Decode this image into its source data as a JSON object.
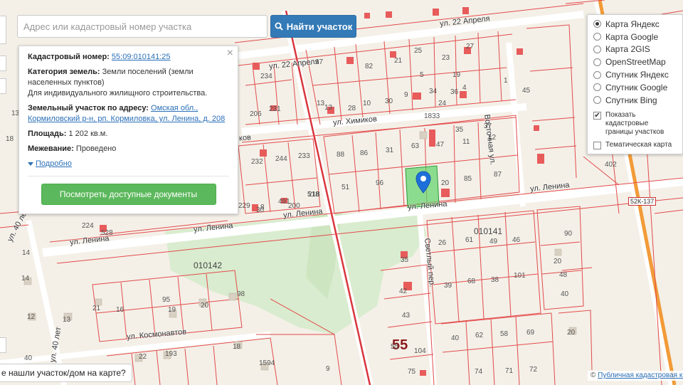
{
  "search": {
    "placeholder": "Адрес или кадастровый номер участка",
    "button_label": "Найти участок",
    "button_icon": "search-icon"
  },
  "info_panel": {
    "cadastral_label": "Кадастровый номер:",
    "cadastral_number": "55:09:010141:25",
    "category_label": "Категория земель:",
    "category_value": "Земли поселений (земли населенных пунктов)",
    "category_purpose": "Для индивидуального жилищного строительства.",
    "address_label": "Земельный участок по адресу:",
    "address_value": "Омская обл., Кормиловский р-н, рп. Кормиловка, ул. Ленина, д. 208",
    "area_label": "Площадь:",
    "area_value": "1 202 кв.м.",
    "survey_label": "Межевание:",
    "survey_value": "Проведено",
    "more_label": "Подробно",
    "docs_button": "Посмотреть доступные документы",
    "close_icon": "close-icon"
  },
  "layers": {
    "options": [
      {
        "label": "Карта Яндекс",
        "selected": true
      },
      {
        "label": "Карта Google",
        "selected": false
      },
      {
        "label": "Карта 2GIS",
        "selected": false
      },
      {
        "label": "OpenStreetMap",
        "selected": false
      },
      {
        "label": "Спутник Яндекс",
        "selected": false
      },
      {
        "label": "Спутник Google",
        "selected": false
      },
      {
        "label": "Спутник Bing",
        "selected": false
      }
    ],
    "show_borders_label": "Показать кадастровые границы участков",
    "show_borders_checked": true,
    "thematic_label": "Тематическая карта",
    "thematic_checked": false
  },
  "map": {
    "streets": {
      "s22april": "ул. 22 Апреля",
      "s22april2": "ул. 22 Апреля",
      "chemists": "ул. Химиков",
      "chemists_partial": "ков",
      "lenina_east": "ул. Ленина",
      "lenina_mid": "ул. Ленина",
      "lenina_w1": "ул. Ленина",
      "lenina_w2": "ул. Ленина",
      "lenina_w3": "ул. Ленина",
      "cosmonauts": "ул. Космонавтов",
      "vostochnaya": "Восточная ул.",
      "svetly": "Светлый пер.",
      "let40": "ул. 40 лет",
      "let40b": "ул. 40 лет"
    },
    "quarters": {
      "q141": "010141",
      "q142": "010142",
      "q55": "55",
      "road": "52К-137"
    },
    "plot_numbers": [
      "25",
      "23",
      "27",
      "17",
      "82",
      "21",
      "19",
      "5",
      "13",
      "10",
      "30",
      "9",
      "234",
      "206",
      "231",
      "1833",
      "28",
      "34",
      "36",
      "24",
      "13",
      "35",
      "37",
      "1",
      "4",
      "45",
      "88",
      "86",
      "31",
      "63",
      "47",
      "11",
      "12",
      "232",
      "244",
      "233",
      "218",
      "96",
      "20",
      "85",
      "87",
      "51",
      "30",
      "491",
      "518",
      "200",
      "229",
      "8",
      "224",
      "528",
      "26",
      "61",
      "49",
      "46",
      "90",
      "35",
      "39",
      "68",
      "38",
      "101",
      "48",
      "42",
      "43",
      "55",
      "104",
      "40",
      "62",
      "58",
      "69",
      "75",
      "74",
      "71",
      "72",
      "14",
      "13",
      "12",
      "21",
      "16",
      "95",
      "19",
      "98",
      "20",
      "22",
      "193",
      "1594",
      "9",
      "18",
      "20",
      "402",
      "40",
      "40",
      "14",
      "13",
      "18",
      "20"
    ],
    "marker_icon": "location-pin-icon"
  },
  "help_text": "е нашли участок/дом на карте?",
  "attribution": {
    "symbol": "©",
    "link": "Публичная кадастровая карта"
  }
}
